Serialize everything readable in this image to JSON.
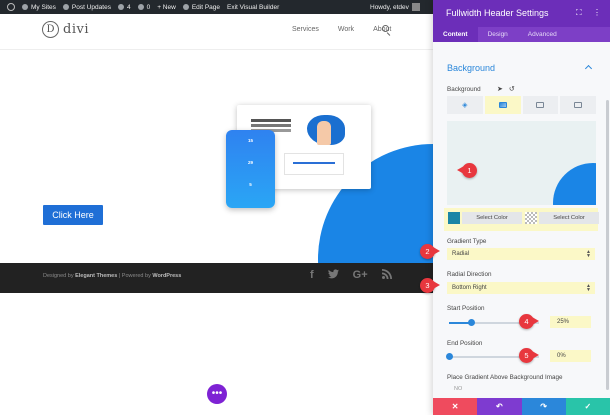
{
  "admin_bar": {
    "my_sites": "My Sites",
    "post_updates": "Post Updates",
    "updates_count": "4",
    "comments_count": "0",
    "new": "+ New",
    "edit_page": "Edit Page",
    "exit_builder": "Exit Visual Builder",
    "howdy": "Howdy, etdev"
  },
  "site": {
    "logo_letter": "D",
    "logo_word": "divi",
    "nav": [
      "Services",
      "Work",
      "About"
    ],
    "cta": "Click Here",
    "phone_stats": [
      "15",
      "29",
      "5"
    ],
    "footer_credits_prefix": "Designed by ",
    "footer_credits_theme": "Elegant Themes",
    "footer_credits_mid": " | Powered by ",
    "footer_credits_wp": "WordPress",
    "social": [
      "f",
      "t",
      "G+",
      "rss"
    ]
  },
  "panel": {
    "title": "Fullwidth Header Settings",
    "tabs": [
      "Content",
      "Design",
      "Advanced"
    ],
    "active_tab": "Content",
    "section_title": "Background",
    "background_label": "Background",
    "gradient_start_color": "#1a85a6",
    "gradient_end_color": "transparent",
    "select_color_1": "Select Color",
    "select_color_2": "Select Color",
    "gradient_type_label": "Gradient Type",
    "gradient_type_value": "Radial",
    "radial_direction_label": "Radial Direction",
    "radial_direction_value": "Bottom Right",
    "start_position_label": "Start Position",
    "start_position_value": "25%",
    "start_position_fraction": 0.25,
    "end_position_label": "End Position",
    "end_position_value": "0%",
    "end_position_fraction": 0.0,
    "place_gradient_label": "Place Gradient Above Background Image",
    "place_gradient_value": "NO"
  },
  "annotations": [
    "1",
    "2",
    "3",
    "4",
    "5"
  ],
  "colors": {
    "accent_purple": "#6c2eb9",
    "accent_blue": "#2b87da",
    "hero_blue": "#1a85e6",
    "highlight": "#fbf8c7",
    "badge_red": "#e8373e",
    "btn_cancel": "#ef4b5e",
    "btn_undo": "#7e3bd0",
    "btn_redo": "#2b87da",
    "btn_save": "#29c4a9"
  }
}
